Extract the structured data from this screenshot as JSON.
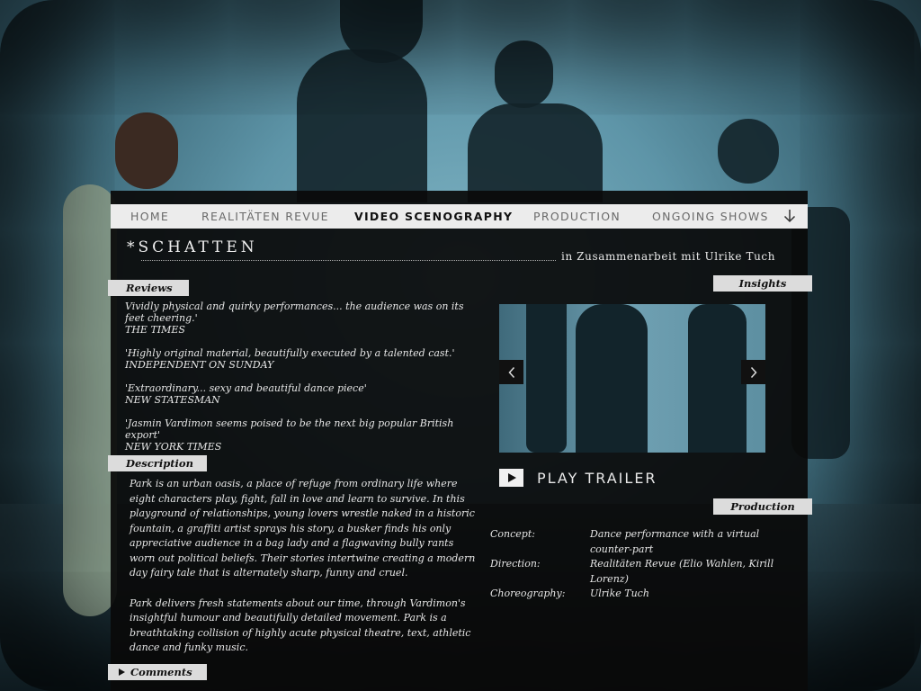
{
  "nav": {
    "items": [
      {
        "label": "HOME",
        "active": false
      },
      {
        "label": "REALITÄTEN REVUE",
        "active": false
      },
      {
        "label": "VIDEO SCENOGRAPHY",
        "active": true
      },
      {
        "label": "PRODUCTION",
        "active": false
      },
      {
        "label": "ONGOING SHOWS",
        "active": false
      }
    ],
    "more_icon": "arrow-down-icon"
  },
  "show": {
    "title": "*SCHATTEN",
    "subtitle": "in Zusammenarbeit mit Ulrike Tuch"
  },
  "sections": {
    "reviews_label": "Reviews",
    "description_label": "Description",
    "comments_label": "Comments",
    "insights_label": "Insights",
    "production_label": "Production"
  },
  "reviews": [
    {
      "quote": "Vividly physical and quirky performances... the audience was on its feet cheering.'",
      "source": "THE TIMES"
    },
    {
      "quote": "'Highly original material, beautifully executed by a talented cast.'",
      "source": "INDEPENDENT ON SUNDAY"
    },
    {
      "quote": "'Extraordinary... sexy and beautiful dance piece'",
      "source": "NEW STATESMAN"
    },
    {
      "quote": "'Jasmin Vardimon seems poised to be the next big popular British export'",
      "source": "NEW YORK TIMES"
    }
  ],
  "description": [
    "Park is an urban oasis, a place of refuge from ordinary life where eight characters play, fight, fall in love and learn to survive. In this playground of relationships, young lovers wrestle naked in a historic fountain, a graffiti artist sprays his story, a busker finds his only appreciative audience in a bag lady and a flagwaving bully rants worn out political beliefs. Their stories intertwine creating a modern day fairy tale that is alternately sharp, funny and cruel.",
    "Park delivers fresh statements about our time, through Vardimon's insightful humour and beautifully detailed movement. Park is a breathtaking collision of highly acute physical theatre, text, athletic dance and funky music."
  ],
  "video": {
    "play_label": "PLAY TRAILER",
    "prev_icon": "chevron-left-icon",
    "next_icon": "chevron-right-icon",
    "play_icon": "play-icon"
  },
  "production": [
    {
      "key": "Concept:",
      "value": "Dance performance with a virtual counter-part"
    },
    {
      "key": "Direction:",
      "value": "Realitäten Revue (Elio Wahlen, Kirill Lorenz)"
    },
    {
      "key": "Choreography:",
      "value": "Ulrike Tuch"
    }
  ],
  "colors": {
    "panel": "#0a0a0a",
    "label_bg": "#dcdcdc",
    "nav_bg": "#ececec",
    "backdrop": "#5e95a8"
  }
}
